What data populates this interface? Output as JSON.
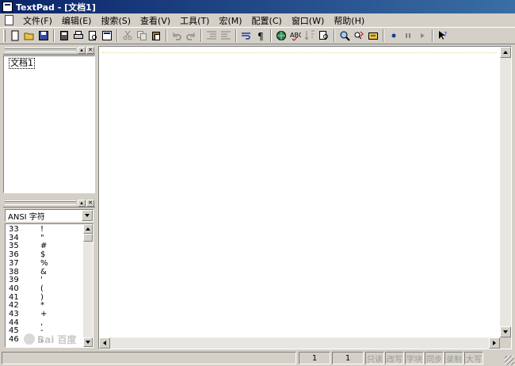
{
  "window": {
    "title": "TextPad - [文档1]"
  },
  "menu": [
    "文件(F)",
    "编辑(E)",
    "搜索(S)",
    "查看(V)",
    "工具(T)",
    "宏(M)",
    "配置(C)",
    "窗口(W)",
    "帮助(H)"
  ],
  "toolbar": {
    "buttons": [
      {
        "name": "new-icon"
      },
      {
        "name": "open-icon"
      },
      {
        "name": "save-icon"
      },
      {
        "name": "sep"
      },
      {
        "name": "save-all-icon"
      },
      {
        "name": "print-icon"
      },
      {
        "name": "print-preview-icon"
      },
      {
        "name": "manage-files-icon"
      },
      {
        "name": "sep"
      },
      {
        "name": "cut-icon",
        "disabled": true
      },
      {
        "name": "copy-icon",
        "disabled": true
      },
      {
        "name": "paste-icon"
      },
      {
        "name": "sep"
      },
      {
        "name": "undo-icon",
        "disabled": true
      },
      {
        "name": "redo-icon",
        "disabled": true
      },
      {
        "name": "sep"
      },
      {
        "name": "indent-icon",
        "disabled": true
      },
      {
        "name": "outdent-icon",
        "disabled": true
      },
      {
        "name": "sep"
      },
      {
        "name": "word-wrap-icon"
      },
      {
        "name": "pilcrow-icon"
      },
      {
        "name": "sep"
      },
      {
        "name": "web-icon"
      },
      {
        "name": "spelling-icon"
      },
      {
        "name": "sort-icon",
        "disabled": true
      },
      {
        "name": "find-in-files-icon"
      },
      {
        "name": "sep"
      },
      {
        "name": "find-icon"
      },
      {
        "name": "replace-icon"
      },
      {
        "name": "goto-icon"
      },
      {
        "name": "sep"
      },
      {
        "name": "record-macro-icon"
      },
      {
        "name": "pause-macro-icon"
      },
      {
        "name": "play-macro-icon"
      },
      {
        "name": "sep"
      },
      {
        "name": "context-help-icon"
      }
    ]
  },
  "panels": {
    "documents": {
      "items": [
        "文档1"
      ]
    },
    "clip_library": {
      "selected": "ANSI 字符",
      "rows": [
        {
          "code": "33",
          "glyph": "!"
        },
        {
          "code": "34",
          "glyph": "\""
        },
        {
          "code": "35",
          "glyph": "#"
        },
        {
          "code": "36",
          "glyph": "$"
        },
        {
          "code": "37",
          "glyph": "%"
        },
        {
          "code": "38",
          "glyph": "&"
        },
        {
          "code": "39",
          "glyph": "'"
        },
        {
          "code": "40",
          "glyph": "("
        },
        {
          "code": "41",
          "glyph": ")"
        },
        {
          "code": "42",
          "glyph": "*"
        },
        {
          "code": "43",
          "glyph": "+"
        },
        {
          "code": "44",
          "glyph": ","
        },
        {
          "code": "45",
          "glyph": "-"
        },
        {
          "code": "46",
          "glyph": "."
        }
      ]
    }
  },
  "status": {
    "line": "1",
    "col": "1",
    "flags": [
      "只读",
      "改写",
      "字块",
      "同步",
      "录制",
      "大写"
    ]
  },
  "watermark": {
    "text": "Bai 百度"
  },
  "colors": {
    "title_start": "#0a246a",
    "title_end": "#3a6ea5",
    "face": "#d4d0c8"
  }
}
